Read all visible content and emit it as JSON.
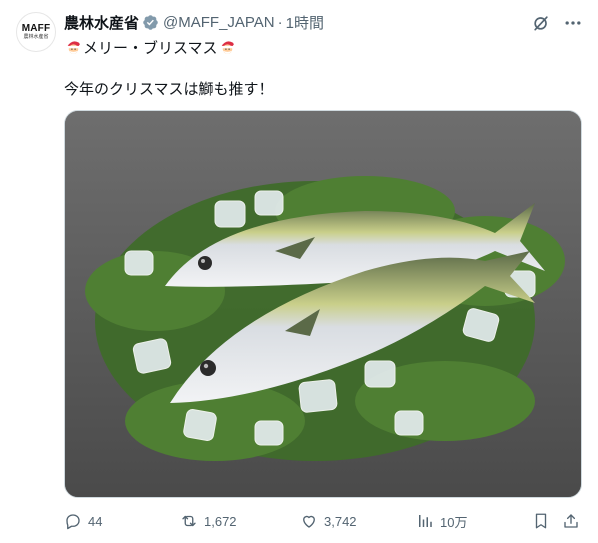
{
  "post": {
    "author_name": "農林水産省",
    "verified": true,
    "handle": "@MAFF_JAPAN",
    "separator": "·",
    "timestamp": "1時間",
    "avatar": {
      "logo_text": "MAFF",
      "logo_subtext": "農林水産省"
    },
    "text_line1": "メリー・ブリスマス",
    "text_line2": "今年のクリスマスは鰤も推す！",
    "line1_emoji": "santa-emoji"
  },
  "actions": {
    "reply_count": "44",
    "repost_count": "1,672",
    "like_count": "3,742",
    "views_count": "10万"
  },
  "colors": {
    "text_primary": "#0f1419",
    "text_secondary": "#536471",
    "verified_badge": "#829aab",
    "border": "#cfd9de"
  },
  "icons": {
    "verified": "verified-badge-icon",
    "grok": "grok-icon",
    "more": "more-icon",
    "reply": "reply-icon",
    "repost": "repost-icon",
    "like": "like-icon",
    "views": "views-icon",
    "bookmark": "bookmark-icon",
    "share": "share-icon"
  }
}
